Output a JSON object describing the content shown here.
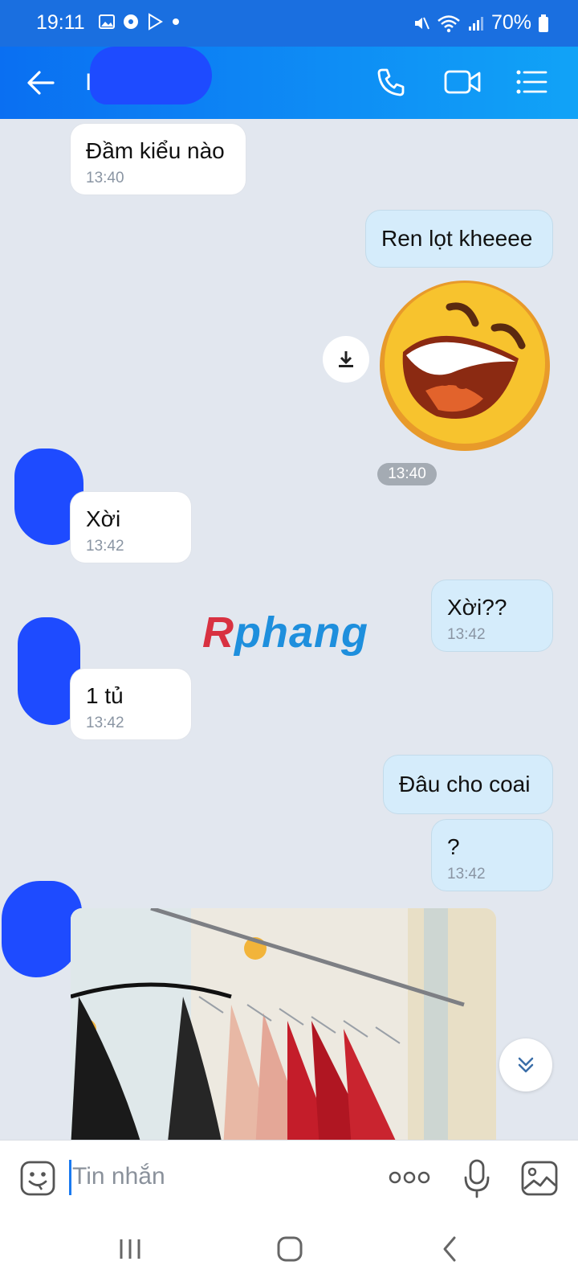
{
  "status_bar": {
    "time": "19:11",
    "battery": "70%"
  },
  "header": {
    "contact_initial": "I"
  },
  "messages": [
    {
      "side": "in",
      "text": "Đầm kiểu nào",
      "time": "13:40"
    },
    {
      "side": "out",
      "text": "Ren lọt kheeee"
    },
    {
      "side": "out",
      "type": "sticker",
      "time": "13:40"
    },
    {
      "side": "in",
      "text": "Xời",
      "time": "13:42"
    },
    {
      "side": "out",
      "text": "Xời??",
      "time": "13:42"
    },
    {
      "side": "in",
      "text": " 1 tủ",
      "time": "13:42"
    },
    {
      "side": "out",
      "text": "Đâu cho coai"
    },
    {
      "side": "out",
      "text": "?",
      "time": "13:42"
    },
    {
      "side": "in",
      "type": "photo"
    }
  ],
  "watermark": {
    "part1": "R",
    "part2": "phang"
  },
  "input": {
    "placeholder": "Tin nhắn"
  },
  "colors": {
    "header_start": "#0a6ff2",
    "header_end": "#11a3f7",
    "outgoing_bubble": "#d5ecfb",
    "incoming_bubble": "#ffffff",
    "chat_background": "#e2e7ef"
  }
}
